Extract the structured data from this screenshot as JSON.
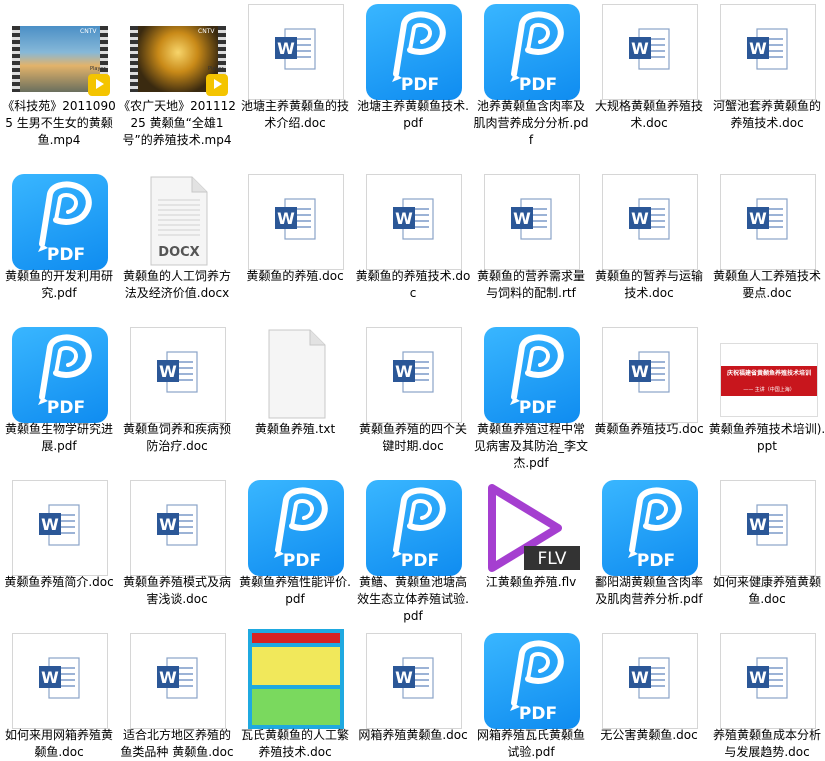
{
  "files": [
    {
      "label": "《科技苑》20110905 生男不生女的黄颡鱼.mp4",
      "type": "mp4-scene1"
    },
    {
      "label": "《农广天地》20111225 黄颡鱼“全雄1号”的养殖技术.mp4",
      "type": "mp4-scene2"
    },
    {
      "label": "池塘主养黄颡鱼的技术介绍.doc",
      "type": "doc"
    },
    {
      "label": "池塘主养黄颡鱼技术.pdf",
      "type": "pdf"
    },
    {
      "label": "池养黄颡鱼含肉率及肌肉营养成分分析.pdf",
      "type": "pdf"
    },
    {
      "label": "大规格黄颡鱼养殖技术.doc",
      "type": "doc"
    },
    {
      "label": "河蟹池套养黄颡鱼的养殖技术.doc",
      "type": "doc"
    },
    {
      "label": "黄颡鱼的开发利用研究.pdf",
      "type": "pdf"
    },
    {
      "label": "黄颡鱼的人工饲养方法及经济价值.docx",
      "type": "docx"
    },
    {
      "label": "黄颡鱼的养殖.doc",
      "type": "doc"
    },
    {
      "label": "黄颡鱼的养殖技术.doc",
      "type": "doc"
    },
    {
      "label": "黄颡鱼的营养需求量与饲料的配制.rtf",
      "type": "doc"
    },
    {
      "label": "黄颡鱼的暂养与运输技术.doc",
      "type": "doc"
    },
    {
      "label": "黄颡鱼人工养殖技术要点.doc",
      "type": "doc"
    },
    {
      "label": "黄颡鱼生物学研究进展.pdf",
      "type": "pdf"
    },
    {
      "label": "黄颡鱼饲养和疾病预防治疗.doc",
      "type": "doc"
    },
    {
      "label": "黄颡鱼养殖.txt",
      "type": "txt"
    },
    {
      "label": "黄颡鱼养殖的四个关键时期.doc",
      "type": "doc"
    },
    {
      "label": "黄颡鱼养殖过程中常见病害及其防治_李文杰.pdf",
      "type": "pdf"
    },
    {
      "label": "黄颡鱼养殖技巧.doc",
      "type": "doc"
    },
    {
      "label": "黄颡鱼养殖技术培训).ppt",
      "type": "ppt"
    },
    {
      "label": "黄颡鱼养殖简介.doc",
      "type": "doc"
    },
    {
      "label": "黄颡鱼养殖模式及病害浅谈.doc",
      "type": "doc"
    },
    {
      "label": "黄颡鱼养殖性能评价.pdf",
      "type": "pdf"
    },
    {
      "label": "黄鳝、黄颡鱼池塘高效生态立体养殖试验.pdf",
      "type": "pdf"
    },
    {
      "label": "江黄颡鱼养殖.flv",
      "type": "flv"
    },
    {
      "label": "鄱阳湖黄颡鱼含肉率及肌肉营养分析.pdf",
      "type": "pdf"
    },
    {
      "label": "如何来健康养殖黄颡鱼.doc",
      "type": "doc"
    },
    {
      "label": "如何来用网箱养殖黄颡鱼.doc",
      "type": "doc"
    },
    {
      "label": "适合北方地区养殖的鱼类品种 黄颡鱼.doc",
      "type": "doc"
    },
    {
      "label": "瓦氏黄颡鱼的人工繁养殖技术.doc",
      "type": "doc-thumb"
    },
    {
      "label": "网箱养殖黄颡鱼.doc",
      "type": "doc"
    },
    {
      "label": "网箱养殖瓦氏黄颡鱼试验.pdf",
      "type": "pdf"
    },
    {
      "label": "无公害黄颡鱼.doc",
      "type": "doc"
    },
    {
      "label": "养殖黄颡鱼成本分析与发展趋势.doc",
      "type": "doc"
    }
  ],
  "badges": {
    "pdf": "PDF",
    "docx": "DOCX",
    "flv": "FLV",
    "player": "Player",
    "cntv": "CNTV",
    "word": "W"
  },
  "ppt_text": {
    "title": "庆祝福建省黄颡鱼养殖技术培训",
    "sub": "—— 主讲（中国上海）"
  },
  "colors": {
    "pdf_blue": "#1a9bf6",
    "word_blue": "#2b5797",
    "flv_purple": "#a53fd0",
    "ppt_red": "#c8161d"
  }
}
